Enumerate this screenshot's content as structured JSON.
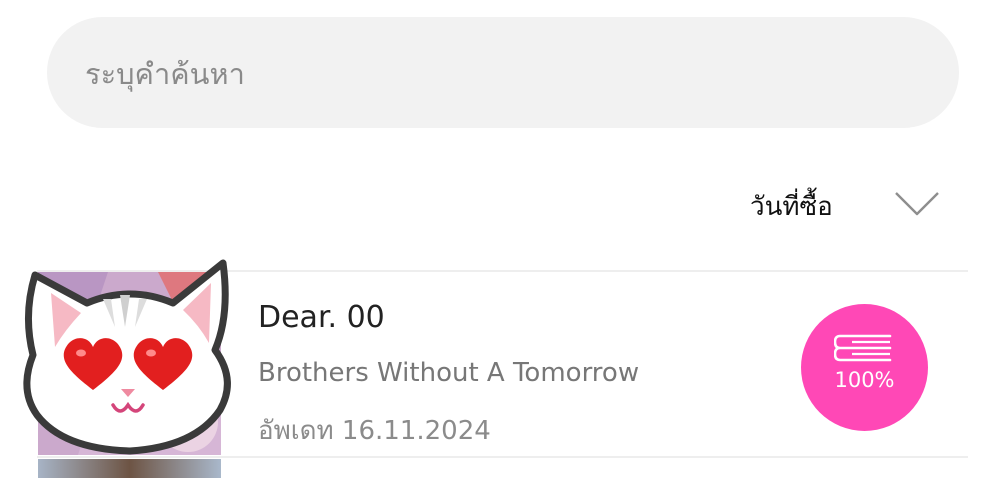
{
  "search": {
    "placeholder": "ระบุคำค้นหา",
    "value": ""
  },
  "sort": {
    "label": "วันที่ซื้อ",
    "icon": "chevron-down-icon"
  },
  "items": [
    {
      "title": "Dear. 00",
      "subtitle": "Brothers Without A Tomorrow",
      "updated": "อัพเดท 16.11.2024",
      "progress": {
        "label": "100%",
        "value": 1.0,
        "color": "#ff48b6",
        "icon": "book-icon"
      },
      "cover_overlay": "cat-heart-eyes-sticker"
    }
  ],
  "colors": {
    "accent": "#ff48b6",
    "search_bg": "#f2f2f2",
    "divider": "#eeeeee",
    "title": "#222222",
    "secondary": "#777777"
  }
}
